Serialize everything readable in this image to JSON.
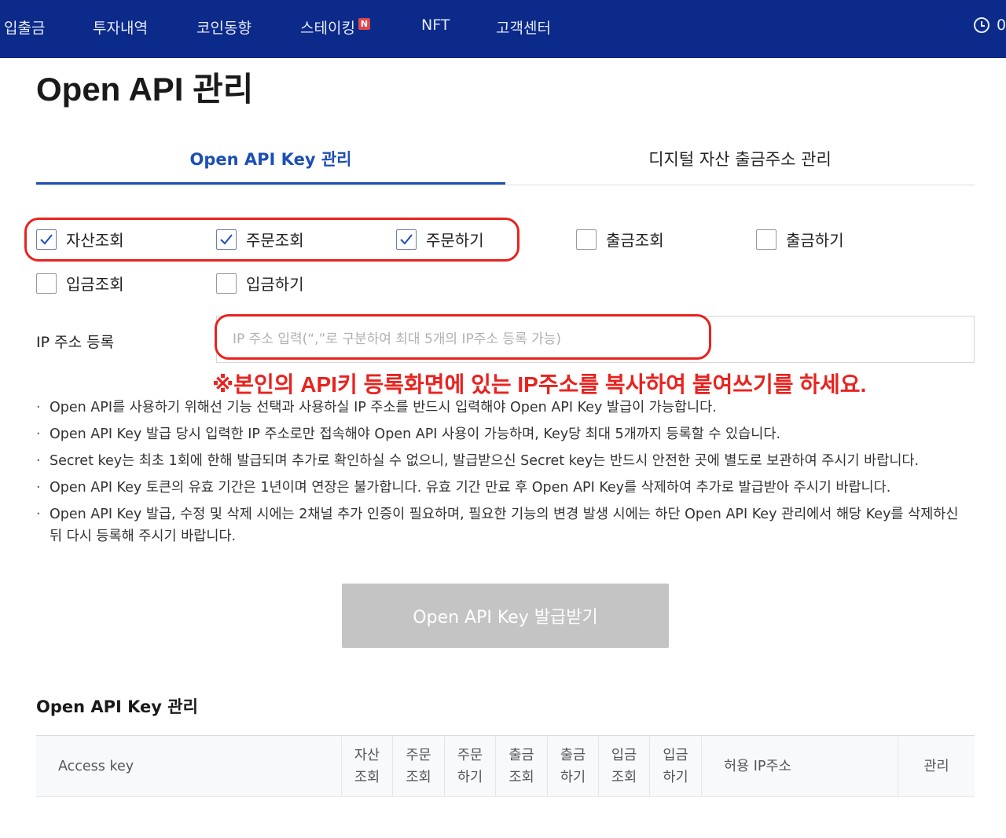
{
  "nav": {
    "items": [
      "입출금",
      "투자내역",
      "코인동향",
      "스테이킹",
      "NFT",
      "고객센터"
    ],
    "staking_badge": "N",
    "clock_text": "0"
  },
  "page": {
    "title": "Open API 관리"
  },
  "tabs": [
    {
      "label": "Open API Key 관리",
      "active": true
    },
    {
      "label": "디지털 자산 출금주소 관리",
      "active": false
    }
  ],
  "permissions": [
    {
      "label": "자산조회",
      "checked": true
    },
    {
      "label": "주문조회",
      "checked": true
    },
    {
      "label": "주문하기",
      "checked": true
    },
    {
      "label": "출금조회",
      "checked": false
    },
    {
      "label": "출금하기",
      "checked": false
    },
    {
      "label": "입금조회",
      "checked": false
    },
    {
      "label": "입금하기",
      "checked": false
    }
  ],
  "ip": {
    "label": "IP 주소 등록",
    "placeholder": "IP 주소 입력(“,”로 구분하여 최대 5개의 IP주소 등록 가능)",
    "value": ""
  },
  "annotation": "※본인의 API키 등록화면에 있는 IP주소를 복사하여 붙여쓰기를 하세요.",
  "notes": [
    "Open API를 사용하기 위해선 기능 선택과 사용하실 IP 주소를 반드시 입력해야 Open API Key 발급이 가능합니다.",
    "Open API Key 발급 당시 입력한 IP 주소로만 접속해야 Open API 사용이 가능하며, Key당 최대 5개까지 등록할 수 있습니다.",
    "Secret key는 최초 1회에 한해 발급되며 추가로 확인하실 수 없으니, 발급받으신 Secret key는 반드시 안전한 곳에 별도로 보관하여 주시기 바랍니다.",
    "Open API Key 토큰의 유효 기간은 1년이며 연장은 불가합니다. 유효 기간 만료 후 Open API Key를 삭제하여 추가로 발급받아 주시기 바랍니다.",
    "Open API Key 발급, 수정 및 삭제 시에는 2채널 추가 인증이 필요하며, 필요한 기능의 변경 발생 시에는 하단 Open API Key 관리에서 해당 Key를 삭제하신 뒤 다시 등록해 주시기 바랍니다."
  ],
  "issue_button": {
    "label": "Open API Key 발급받기"
  },
  "key_table": {
    "title": "Open API Key 관리",
    "columns": [
      "Access key",
      "자산\n조회",
      "주문\n조회",
      "주문\n하기",
      "출금\n조회",
      "출금\n하기",
      "입금\n조회",
      "입금\n하기",
      "허용 IP주소",
      "관리"
    ]
  },
  "colors": {
    "nav_bg": "#0b2a8a",
    "accent": "#1d4fb4",
    "highlight": "#e8231f",
    "button_disabled": "#c4c4c4"
  }
}
